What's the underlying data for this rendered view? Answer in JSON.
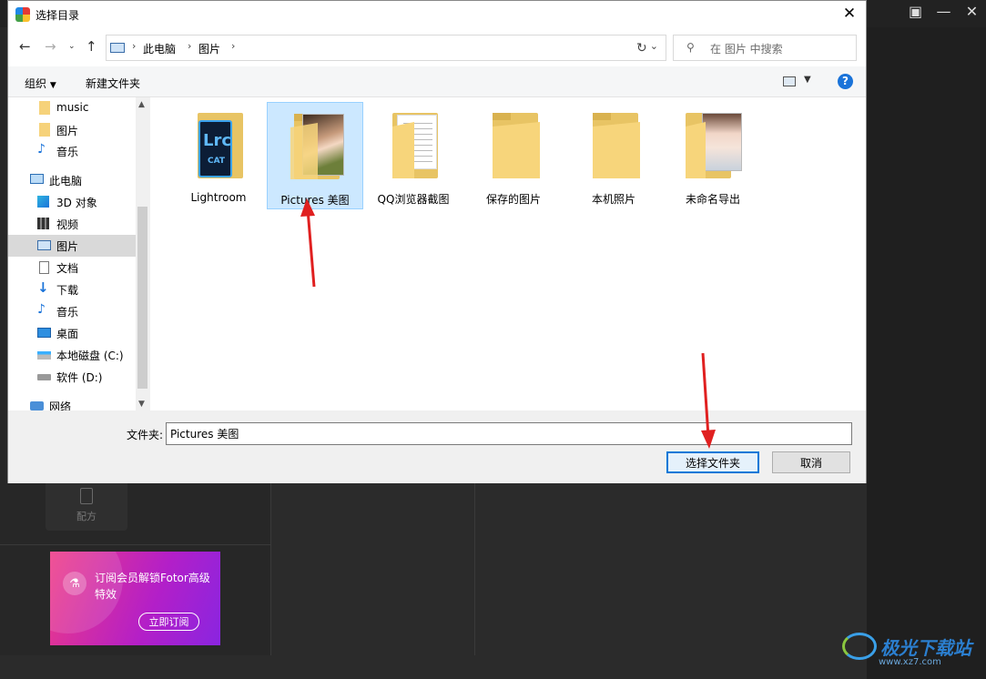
{
  "dialog": {
    "title": "选择目录",
    "address": {
      "crumbs": [
        "此电脑",
        "图片"
      ]
    },
    "search_placeholder": "在 图片 中搜索",
    "toolbar": {
      "organize": "组织",
      "new_folder": "新建文件夹",
      "help": "?"
    },
    "tree": [
      {
        "label": "music",
        "icon": "folder-icon"
      },
      {
        "label": "图片",
        "icon": "folder-icon"
      },
      {
        "label": "音乐",
        "icon": "music-icon"
      },
      {
        "label": "此电脑",
        "icon": "computer-icon"
      },
      {
        "label": "3D 对象",
        "icon": "cube-icon"
      },
      {
        "label": "视频",
        "icon": "video-icon"
      },
      {
        "label": "图片",
        "icon": "pictures-icon",
        "selected": true
      },
      {
        "label": "文档",
        "icon": "document-icon"
      },
      {
        "label": "下载",
        "icon": "download-icon"
      },
      {
        "label": "音乐",
        "icon": "music-icon"
      },
      {
        "label": "桌面",
        "icon": "desktop-icon"
      },
      {
        "label": "本地磁盘 (C:)",
        "icon": "drive-icon"
      },
      {
        "label": "软件 (D:)",
        "icon": "drive-icon"
      },
      {
        "label": "网络",
        "icon": "network-icon"
      }
    ],
    "folders": [
      {
        "label": "Lightroom"
      },
      {
        "label": "Pictures 美图",
        "selected": true
      },
      {
        "label": "QQ浏览器截图"
      },
      {
        "label": "保存的图片"
      },
      {
        "label": "本机照片"
      },
      {
        "label": "未命名导出"
      }
    ],
    "lrc_badge": {
      "top": "Lrc",
      "bottom": "CAT"
    },
    "folder_label": "文件夹:",
    "folder_value": "Pictures 美图",
    "select_button": "选择文件夹",
    "cancel_button": "取消"
  },
  "background": {
    "recipe_label": "配方",
    "promo_text": "订阅会员解锁Fotor高级特效",
    "promo_button": "立即订阅",
    "watermark": "极光下载站",
    "watermark_url": "www.xz7.com"
  },
  "colors": {
    "accent": "#0078d7",
    "selection": "#cce8ff",
    "arrow": "#e02020"
  }
}
